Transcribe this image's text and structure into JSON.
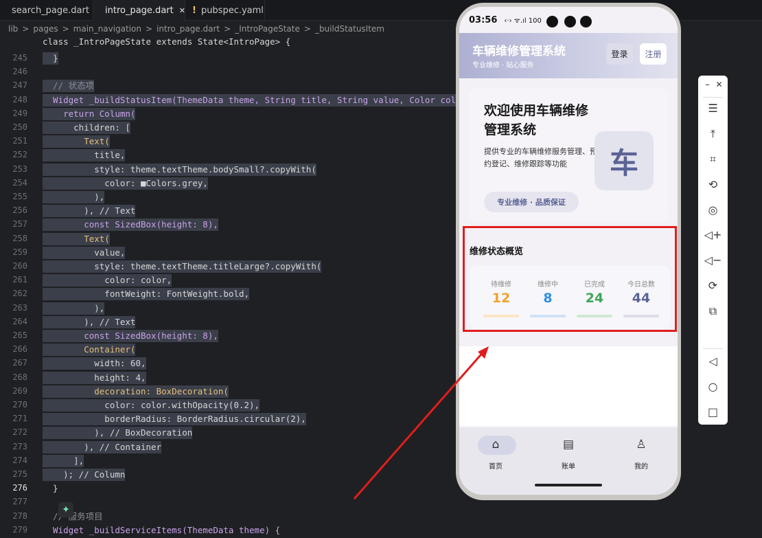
{
  "editor": {
    "tabs": [
      {
        "label": "search_page.dart",
        "icon": "flutter-icon"
      },
      {
        "label": "intro_page.dart",
        "icon": "flutter-icon",
        "close": "✕"
      },
      {
        "label": "pubspec.yaml",
        "icon": "warning-icon"
      }
    ],
    "breadcrumb": [
      "lib",
      ">",
      "pages",
      ">",
      "main_navigation",
      ">",
      "intro_page.dart",
      ">",
      "_IntroPageState",
      ">",
      "_buildStatusItem"
    ],
    "top_line": "class _IntroPageState extends State<IntroPage> {",
    "line_numbers": [
      "245",
      "246",
      "247",
      "248",
      "249",
      "250",
      "251",
      "252",
      "253",
      "254",
      "255",
      "256",
      "257",
      "258",
      "259",
      "260",
      "261",
      "262",
      "263",
      "264",
      "265",
      "266",
      "267",
      "268",
      "269",
      "270",
      "271",
      "272",
      "273",
      "274",
      "275",
      "276",
      "277",
      "278",
      "279"
    ],
    "current_line": "276",
    "lines": [
      "  }",
      "",
      "  // 状态项",
      "  Widget _buildStatusItem(ThemeData theme, String title, String value, Color color) {",
      "    return Column(",
      "      children: [",
      "        Text(",
      "          title,",
      "          style: theme.textTheme.bodySmall?.copyWith(",
      "            color: ■Colors.grey,",
      "          ),",
      "        ), // Text",
      "        const SizedBox(height: 8),",
      "        Text(",
      "          value,",
      "          style: theme.textTheme.titleLarge?.copyWith(",
      "            color: color,",
      "            fontWeight: FontWeight.bold,",
      "          ),",
      "        ), // Text",
      "        const SizedBox(height: 8),",
      "        Container(",
      "          width: 60,",
      "          height: 4,",
      "          decoration: BoxDecoration(",
      "            color: color.withOpacity(0.2),",
      "            borderRadius: BorderRadius.circular(2),",
      "          ), // BoxDecoration",
      "        ), // Container",
      "      ],",
      "    ); // Column",
      "  }",
      "",
      "  // 服务项目",
      "  Widget _buildServiceItems(ThemeData theme) {"
    ]
  },
  "phone": {
    "status_bar": {
      "time": "03:56",
      "indicators": "‹·› ᯤ.ıl 100"
    },
    "app_bar": {
      "title": "车辆维修管理系统",
      "subtitle": "专业维修 · 贴心服务",
      "login_label": "登录",
      "register_label": "注册"
    },
    "hero": {
      "title": "欢迎使用车辆维修管理系统",
      "description": "提供专业的车辆维修服务管理、预约登记、维修跟踪等功能",
      "chip": "专业维修 · 品质保证",
      "logo_char": "车"
    },
    "overview": {
      "title": "维修状态概览",
      "stats": [
        {
          "label": "待维修",
          "value": "12",
          "color": "#f2a12b",
          "bar": "#fbe5c4"
        },
        {
          "label": "维修中",
          "value": "8",
          "color": "#2f8fe0",
          "bar": "#cfe2f6"
        },
        {
          "label": "已完成",
          "value": "24",
          "color": "#3fa65a",
          "bar": "#cfe9d4"
        },
        {
          "label": "今日总数",
          "value": "44",
          "color": "#5b6394",
          "bar": "#dcdde9"
        }
      ]
    },
    "bottom_nav": [
      {
        "label": "首页",
        "icon": "home-icon",
        "glyph": "⌂",
        "active": true
      },
      {
        "label": "账单",
        "icon": "bill-icon",
        "glyph": "▤",
        "active": false
      },
      {
        "label": "我的",
        "icon": "person-icon",
        "glyph": "♙",
        "active": false
      }
    ]
  },
  "emulator_panel": {
    "minimize": "–",
    "close": "✕",
    "tools": [
      {
        "icon": "menu-icon",
        "glyph": "☰"
      },
      {
        "icon": "pin-top-icon",
        "glyph": "⤒"
      },
      {
        "icon": "crop-icon",
        "glyph": "⌗"
      },
      {
        "icon": "rotate-icon",
        "glyph": "⟲"
      },
      {
        "icon": "record-icon",
        "glyph": "◎"
      },
      {
        "icon": "volume-up-icon",
        "glyph": "◁+"
      },
      {
        "icon": "volume-down-icon",
        "glyph": "◁−"
      },
      {
        "icon": "screen-rotate-icon",
        "glyph": "⟳"
      },
      {
        "icon": "multi-screen-icon",
        "glyph": "⧉"
      }
    ],
    "nav": [
      {
        "icon": "back-icon",
        "glyph": "◁"
      },
      {
        "icon": "home-circle-icon",
        "glyph": "○"
      },
      {
        "icon": "recents-icon",
        "glyph": "□"
      }
    ]
  },
  "annotation": {
    "color": "#e01d1d"
  }
}
